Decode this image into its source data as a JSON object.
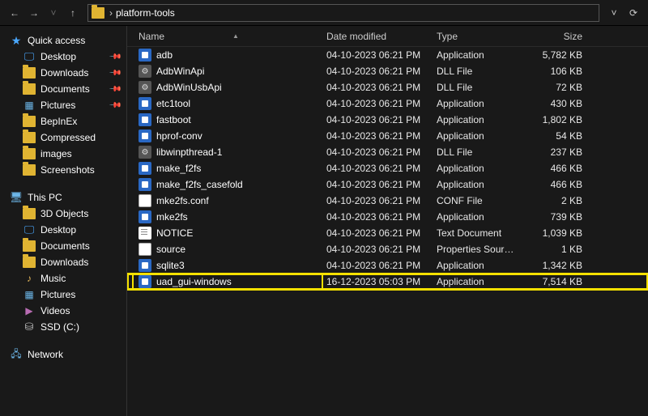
{
  "breadcrumb": {
    "folder": "platform-tools"
  },
  "sidebar": {
    "quick_access": "Quick access",
    "items_qa": [
      {
        "label": "Desktop",
        "icon": "desktop",
        "pinned": true
      },
      {
        "label": "Downloads",
        "icon": "folder",
        "pinned": true
      },
      {
        "label": "Documents",
        "icon": "folder",
        "pinned": true
      },
      {
        "label": "Pictures",
        "icon": "pics",
        "pinned": true
      },
      {
        "label": "BepInEx",
        "icon": "folder",
        "pinned": false
      },
      {
        "label": "Compressed",
        "icon": "folder",
        "pinned": false
      },
      {
        "label": "images",
        "icon": "folder",
        "pinned": false
      },
      {
        "label": "Screenshots",
        "icon": "folder",
        "pinned": false
      }
    ],
    "this_pc": "This PC",
    "items_pc": [
      {
        "label": "3D Objects",
        "icon": "folder"
      },
      {
        "label": "Desktop",
        "icon": "desktop"
      },
      {
        "label": "Documents",
        "icon": "folder"
      },
      {
        "label": "Downloads",
        "icon": "folder"
      },
      {
        "label": "Music",
        "icon": "music"
      },
      {
        "label": "Pictures",
        "icon": "pics"
      },
      {
        "label": "Videos",
        "icon": "vids"
      },
      {
        "label": "SSD (C:)",
        "icon": "disk"
      }
    ],
    "network": "Network"
  },
  "columns": {
    "name": "Name",
    "date": "Date modified",
    "type": "Type",
    "size": "Size"
  },
  "files": [
    {
      "name": "adb",
      "date": "04-10-2023 06:21 PM",
      "type": "Application",
      "size": "5,782 KB",
      "icon": "exe"
    },
    {
      "name": "AdbWinApi",
      "date": "04-10-2023 06:21 PM",
      "type": "DLL File",
      "size": "106 KB",
      "icon": "dll"
    },
    {
      "name": "AdbWinUsbApi",
      "date": "04-10-2023 06:21 PM",
      "type": "DLL File",
      "size": "72 KB",
      "icon": "dll"
    },
    {
      "name": "etc1tool",
      "date": "04-10-2023 06:21 PM",
      "type": "Application",
      "size": "430 KB",
      "icon": "exe"
    },
    {
      "name": "fastboot",
      "date": "04-10-2023 06:21 PM",
      "type": "Application",
      "size": "1,802 KB",
      "icon": "exe"
    },
    {
      "name": "hprof-conv",
      "date": "04-10-2023 06:21 PM",
      "type": "Application",
      "size": "54 KB",
      "icon": "exe"
    },
    {
      "name": "libwinpthread-1",
      "date": "04-10-2023 06:21 PM",
      "type": "DLL File",
      "size": "237 KB",
      "icon": "dll"
    },
    {
      "name": "make_f2fs",
      "date": "04-10-2023 06:21 PM",
      "type": "Application",
      "size": "466 KB",
      "icon": "exe"
    },
    {
      "name": "make_f2fs_casefold",
      "date": "04-10-2023 06:21 PM",
      "type": "Application",
      "size": "466 KB",
      "icon": "exe"
    },
    {
      "name": "mke2fs.conf",
      "date": "04-10-2023 06:21 PM",
      "type": "CONF File",
      "size": "2 KB",
      "icon": "conf"
    },
    {
      "name": "mke2fs",
      "date": "04-10-2023 06:21 PM",
      "type": "Application",
      "size": "739 KB",
      "icon": "exe"
    },
    {
      "name": "NOTICE",
      "date": "04-10-2023 06:21 PM",
      "type": "Text Document",
      "size": "1,039 KB",
      "icon": "txt"
    },
    {
      "name": "source",
      "date": "04-10-2023 06:21 PM",
      "type": "Properties Source ...",
      "size": "1 KB",
      "icon": "unk"
    },
    {
      "name": "sqlite3",
      "date": "04-10-2023 06:21 PM",
      "type": "Application",
      "size": "1,342 KB",
      "icon": "exe"
    },
    {
      "name": "uad_gui-windows",
      "date": "16-12-2023 05:03 PM",
      "type": "Application",
      "size": "7,514 KB",
      "icon": "exe",
      "highlight": true
    }
  ]
}
